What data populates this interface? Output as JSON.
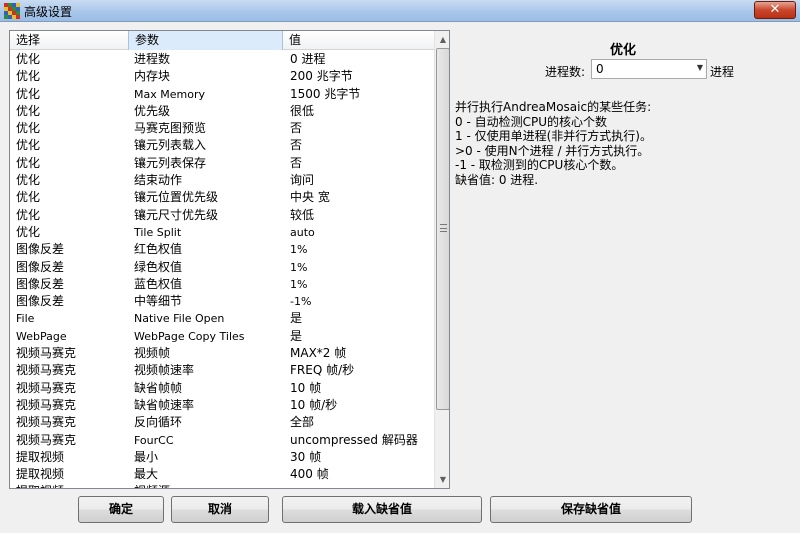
{
  "window": {
    "title": "高级设置",
    "close_label": "✕"
  },
  "grid": {
    "headers": [
      "选择",
      "参数",
      "值"
    ],
    "rows": [
      [
        "优化",
        "进程数",
        "0 进程"
      ],
      [
        "优化",
        "内存块",
        "200 兆字节"
      ],
      [
        "优化",
        "Max Memory",
        "1500 兆字节"
      ],
      [
        "优化",
        "优先级",
        "很低"
      ],
      [
        "优化",
        "马赛克图预览",
        "否"
      ],
      [
        "优化",
        "镶元列表载入",
        "否"
      ],
      [
        "优化",
        "镶元列表保存",
        "否"
      ],
      [
        "优化",
        "结束动作",
        "询问"
      ],
      [
        "优化",
        "镶元位置优先级",
        "中央 宽"
      ],
      [
        "优化",
        "镶元尺寸优先级",
        "较低"
      ],
      [
        "优化",
        "Tile Split",
        "auto"
      ],
      [
        "图像反差",
        "红色权值",
        "1%"
      ],
      [
        "图像反差",
        "绿色权值",
        "1%"
      ],
      [
        "图像反差",
        "蓝色权值",
        "1%"
      ],
      [
        "图像反差",
        "中等细节",
        "-1%"
      ],
      [
        "File",
        "Native File Open",
        "是"
      ],
      [
        "WebPage",
        "WebPage Copy Tiles",
        "是"
      ],
      [
        "视频马赛克",
        "视频帧",
        "MAX*2 帧"
      ],
      [
        "视频马赛克",
        "视频帧速率",
        "FREQ 帧/秒"
      ],
      [
        "视频马赛克",
        "缺省帧帧",
        "10 帧"
      ],
      [
        "视频马赛克",
        "缺省帧速率",
        "10 帧/秒"
      ],
      [
        "视频马赛克",
        "反向循环",
        "全部"
      ],
      [
        "视频马赛克",
        "FourCC",
        "uncompressed 解码器"
      ],
      [
        "提取视频",
        "最小",
        "30 帧"
      ],
      [
        "提取视频",
        "最大",
        "400 帧"
      ],
      [
        "提取视频",
        "视频源",
        ""
      ]
    ]
  },
  "panel": {
    "title": "优化",
    "processes_label": "进程数:",
    "processes_value": "0",
    "processes_suffix": "进程",
    "description": [
      "并行执行AndreaMosaic的某些任务:",
      " 0 - 自动检测CPU的核心个数",
      " 1 - 仅使用单进程(非并行方式执行)。",
      " >0 - 使用N个进程 / 并行方式执行。",
      " -1 - 取检测到的CPU核心个数。",
      "缺省值: 0 进程."
    ]
  },
  "buttons": {
    "ok": "确定",
    "cancel": "取消",
    "load_defaults": "载入缺省值",
    "save_defaults": "保存缺省值"
  },
  "colors": {
    "titlebar": "#a9c6ea",
    "close_button": "#c9462c",
    "header_highlight": "#dcebfc",
    "app_icon": [
      "#d42b2b",
      "#2f8f2f",
      "#2f5fcf",
      "#e8c020"
    ]
  },
  "icons": {
    "app": "andreamosaic-app-icon",
    "close": "close-icon",
    "dropdown": "chevron-down-icon",
    "scroll_up": "scroll-up-arrow",
    "scroll_down": "scroll-down-arrow"
  }
}
